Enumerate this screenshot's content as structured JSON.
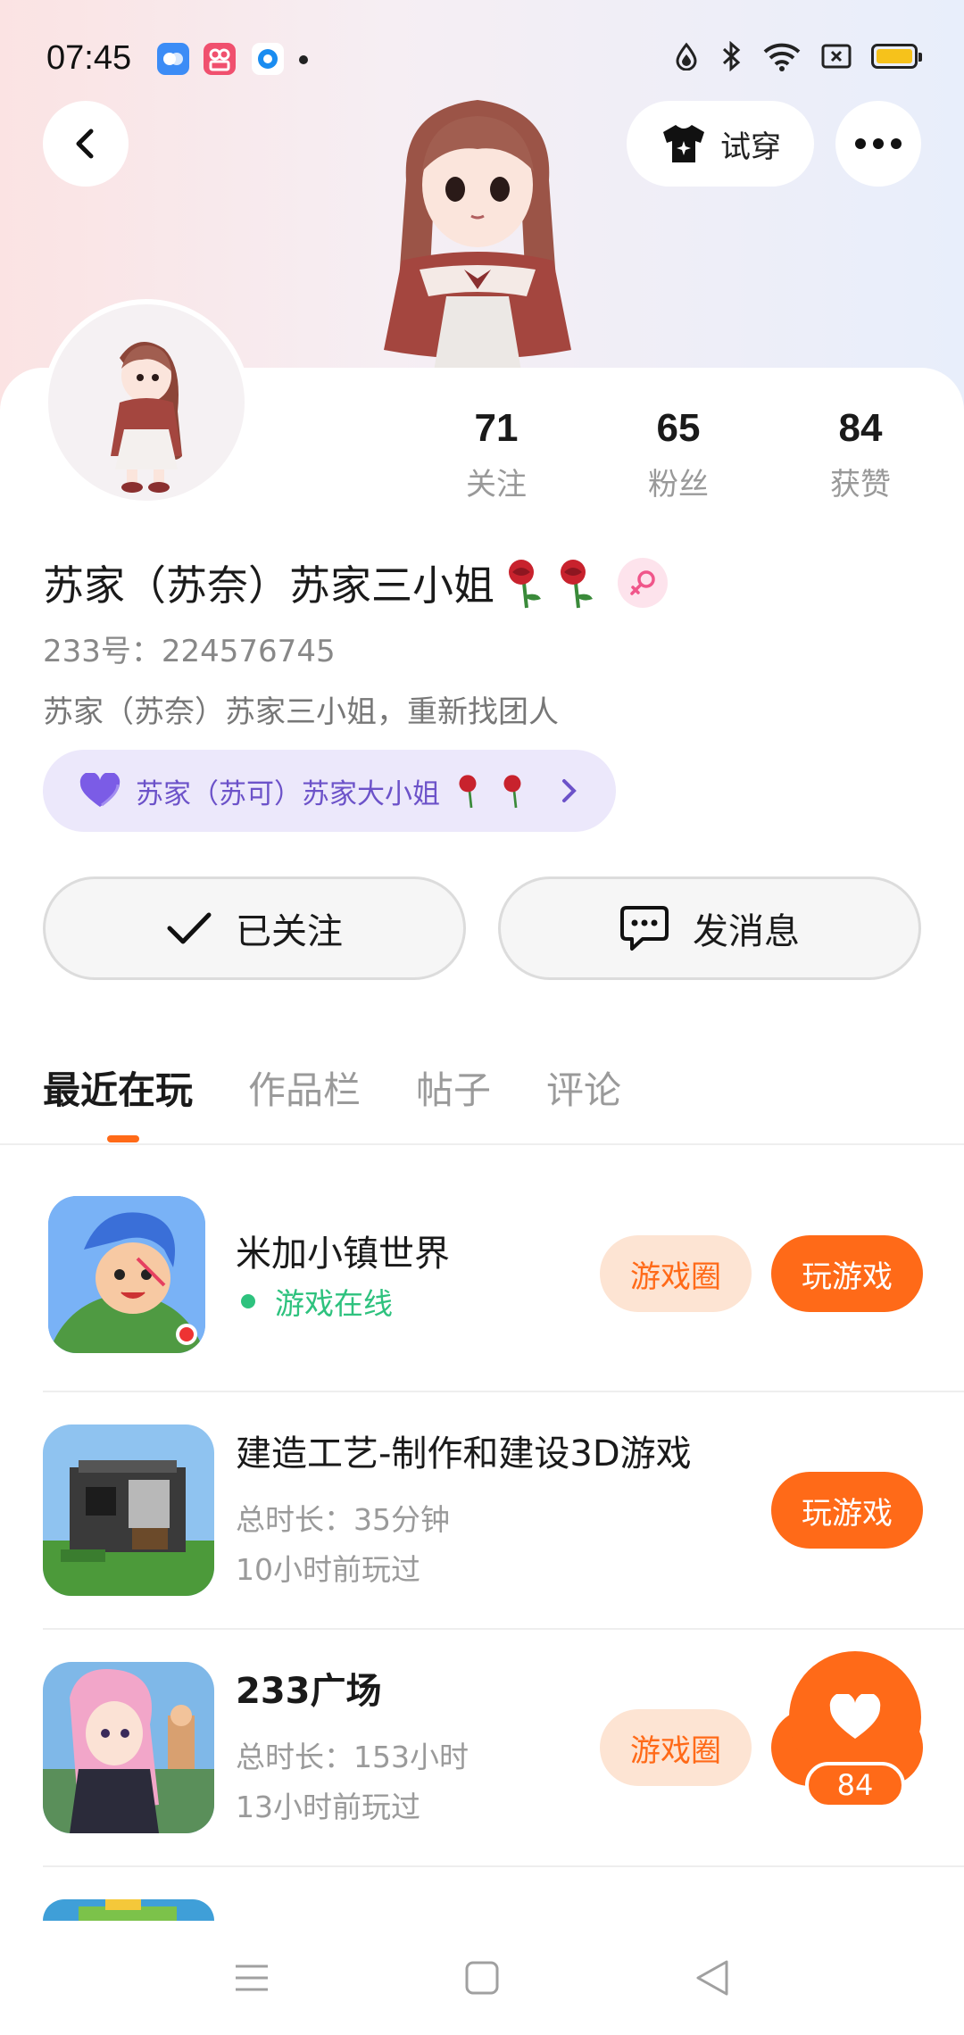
{
  "status_bar": {
    "time": "07:45"
  },
  "top": {
    "back_label": "back",
    "tryon_label": "试穿",
    "more_label": "more"
  },
  "profile": {
    "stats": [
      {
        "value": "71",
        "label": "关注"
      },
      {
        "value": "65",
        "label": "粉丝"
      },
      {
        "value": "84",
        "label": "获赞"
      }
    ],
    "username": "苏家（苏奈）苏家三小姐",
    "uid": "233号：224576745",
    "bio": "苏家（苏奈）苏家三小姐，重新找团人",
    "relation": "苏家（苏可）苏家大小姐"
  },
  "actions": {
    "follow_label": "已关注",
    "message_label": "发消息"
  },
  "tabs": [
    {
      "label": "最近在玩"
    },
    {
      "label": "作品栏"
    },
    {
      "label": "帖子"
    },
    {
      "label": "评论"
    }
  ],
  "games": [
    {
      "title": "米加小镇世界",
      "status": "游戏在线",
      "circle": "游戏圈",
      "play": "玩游戏"
    },
    {
      "title": "建造工艺-制作和建设3D游戏",
      "duration": "总时长：35分钟",
      "last_played": "10小时前玩过",
      "play": "玩游戏"
    },
    {
      "title": "233广场",
      "duration": "总时长：153小时",
      "last_played": "13小时前玩过",
      "circle": "游戏圈"
    }
  ],
  "like_button": {
    "count": "84"
  },
  "colors": {
    "accent": "#ff6a18",
    "online": "#2ec27e",
    "relation": "#6c52c9"
  }
}
